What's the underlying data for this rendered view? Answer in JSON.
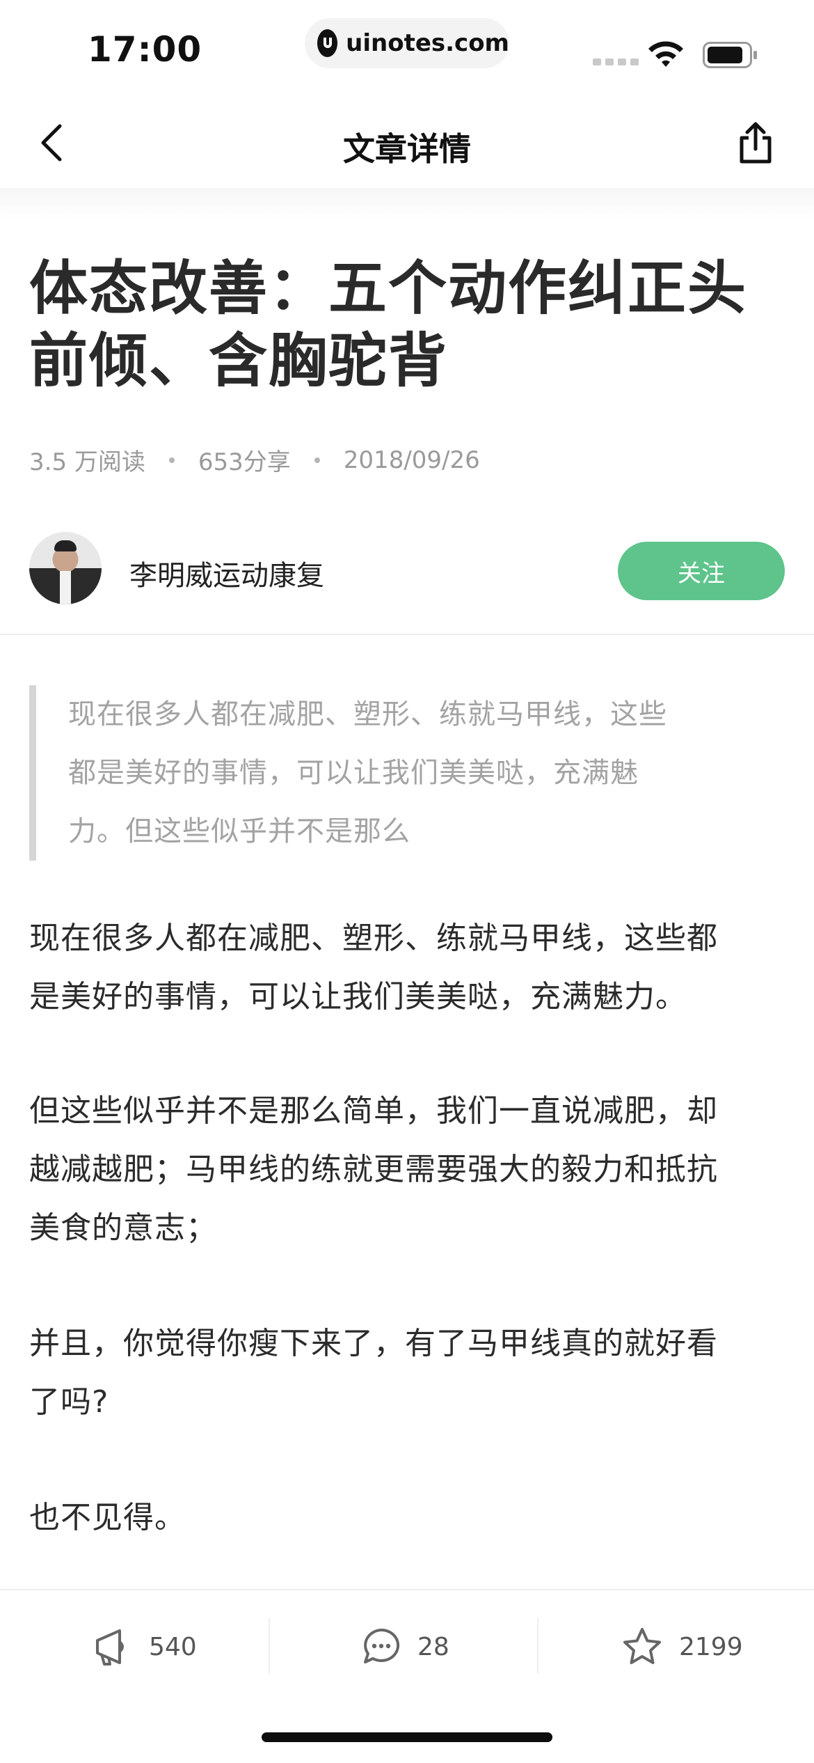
{
  "status_bar": {
    "time": "17:00",
    "url": "uinotes.com"
  },
  "nav": {
    "title": "文章详情",
    "back_icon": "chevron-left-icon",
    "share_icon": "share-icon"
  },
  "article": {
    "title_line1": "体态改善：五个动作纠正头",
    "title_line2": "前倾、含胸驼背",
    "reads": "3.5 万阅读",
    "shares": "653分享",
    "date": "2018/09/26"
  },
  "author": {
    "name": "李明威运动康复",
    "follow_label": "关注"
  },
  "colors": {
    "accent": "#5ec48b",
    "quote_bar": "#d6d6d6",
    "meta_text": "#9a9a9a"
  },
  "quote": {
    "line1": "现在很多人都在减肥、塑形、练就马甲线，这些",
    "line2": "都是美好的事情，可以让我们美美哒，充满魅",
    "line3": "力。但这些似乎并不是那么"
  },
  "body": {
    "p1_line1": "现在很多人都在减肥、塑形、练就马甲线，这些都",
    "p1_line2": "是美好的事情，可以让我们美美哒，充满魅力。",
    "p2_line1": "但这些似乎并不是那么简单，我们一直说减肥，却",
    "p2_line2": "越减越肥；马甲线的练就更需要强大的毅力和抵抗",
    "p2_line3": "美食的意志；",
    "p3_line1": "并且，你觉得你瘦下来了，有了马甲线真的就好看",
    "p3_line2": "了吗?",
    "p4_line1": "也不见得。"
  },
  "bottom_bar": {
    "like_count": "540",
    "comment_count": "28",
    "favorite_count": "2199"
  }
}
